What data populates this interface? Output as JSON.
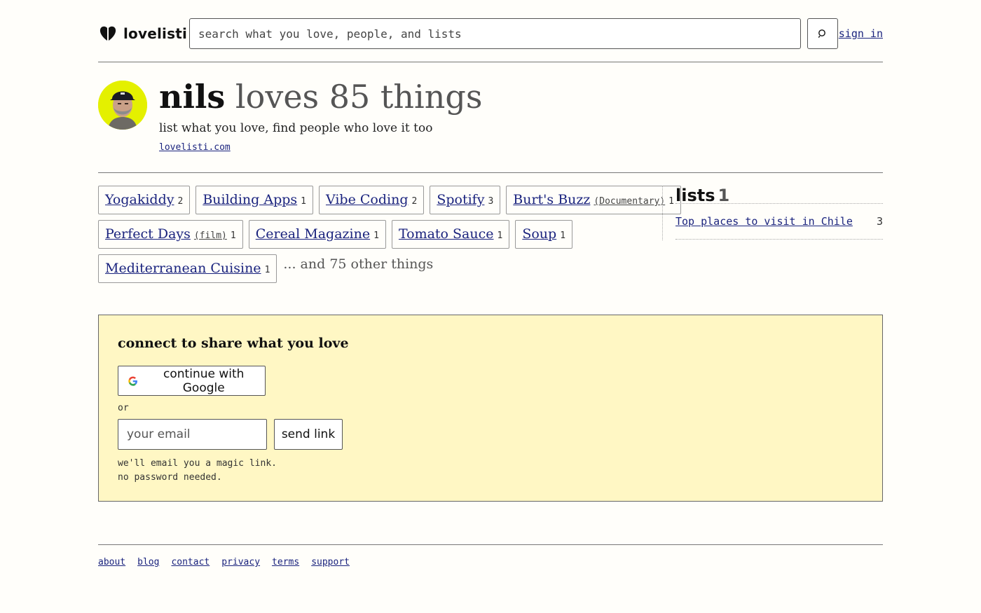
{
  "header": {
    "brand": "lovelisti",
    "search_placeholder": "search what you love, people, and lists",
    "sign_in": "sign in"
  },
  "profile": {
    "name": "nils",
    "loves_text": "loves 85 things",
    "tagline": "list what you love, find people who love it too",
    "link": "lovelisti.com"
  },
  "things": {
    "items": [
      {
        "label": "Yogakiddy",
        "sub": "",
        "count": "2"
      },
      {
        "label": "Building Apps",
        "sub": "",
        "count": "1"
      },
      {
        "label": "Vibe Coding",
        "sub": "",
        "count": "2"
      },
      {
        "label": "Spotify",
        "sub": "",
        "count": "3"
      },
      {
        "label": "Burt's Buzz",
        "sub": "(Documentary)",
        "count": "1"
      },
      {
        "label": "Perfect Days",
        "sub": "(film)",
        "count": "1"
      },
      {
        "label": "Cereal Magazine",
        "sub": "",
        "count": "1"
      },
      {
        "label": "Tomato Sauce",
        "sub": "",
        "count": "1"
      },
      {
        "label": "Soup",
        "sub": "",
        "count": "1"
      },
      {
        "label": "Mediterranean Cuisine",
        "sub": "",
        "count": "1"
      }
    ],
    "more": "... and 75 other things"
  },
  "lists": {
    "heading": "lists",
    "count": "1",
    "items": [
      {
        "title": "Top places to visit in Chile",
        "count": "3"
      }
    ]
  },
  "connect": {
    "title": "connect to share what you love",
    "google_button": "continue with Google",
    "or": "or",
    "email_placeholder": "your email",
    "send_button": "send link",
    "hint_line1": "we'll email you a magic link.",
    "hint_line2": "no password needed."
  },
  "footer": {
    "links": [
      "about",
      "blog",
      "contact",
      "privacy",
      "terms",
      "support"
    ]
  },
  "colors": {
    "background": "#fffefa",
    "link": "#1a237e",
    "connect_bg": "#fff7c4",
    "avatar_bg": "#e4f000"
  }
}
